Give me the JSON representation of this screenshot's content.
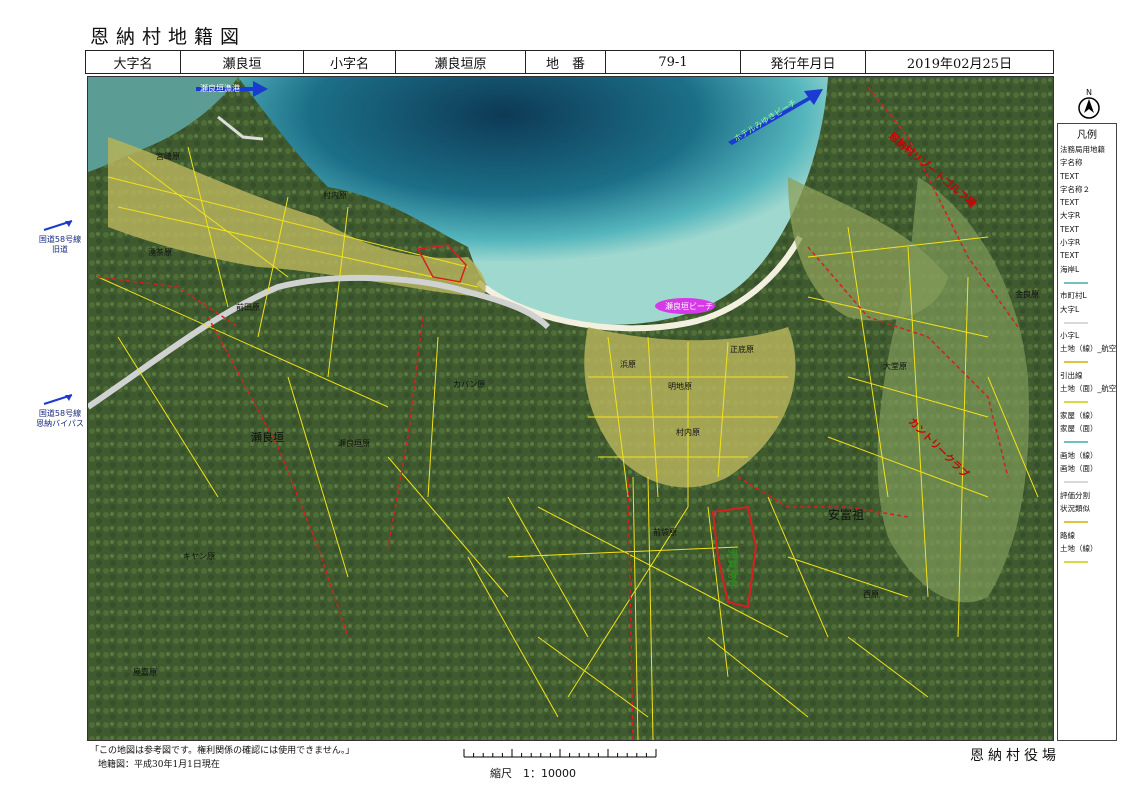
{
  "title": "恩納村地籍図",
  "header": {
    "oaza_label": "大字名",
    "oaza_value": "瀬良垣",
    "koaza_label": "小字名",
    "koaza_value": "瀬良垣原",
    "chiban_label": "地　番",
    "chiban_value": "79-1",
    "date_label": "発行年月日",
    "date_value": "2019年02月25日"
  },
  "map": {
    "labels": {
      "port": "瀬良垣漁港",
      "hotel": "ホテルみゆきビーチ",
      "beach": "瀬良垣ビーチ",
      "p1": "宮崎原",
      "p2": "村内原",
      "p3": "湧茶原",
      "p4": "前田原",
      "p5": "浜原",
      "p6": "正底原",
      "p7": "明地原",
      "p8": "村内原",
      "p9": "大堂原",
      "p10": "金良原",
      "p11": "カバン原",
      "p12": "瀬良垣",
      "p13": "瀬良垣原",
      "p14": "キヤン原",
      "p15": "前袋原",
      "p16": "安富祖",
      "p17": "西原",
      "p18": "屋嘉原",
      "property": "売買物件",
      "resort1": "恩納村リゾートゴルフ場",
      "resort2": "カントリークラブ"
    },
    "left_notes": {
      "note1_line1": "国道58号線",
      "note1_line2": "旧道",
      "note2_line1": "国道58号線",
      "note2_line2": "恩納バイパス"
    }
  },
  "legend": {
    "title": "凡例",
    "items": [
      "法務局用地籍",
      "字名称",
      "TEXT",
      "字名称２",
      "TEXT",
      "大字R",
      "TEXT",
      "小字R",
      "TEXT",
      "海岸L",
      "市町村L",
      "大字L",
      "小字L",
      "土地（線）_航空",
      "引出線",
      "土地（面）_航空",
      "家屋（線）",
      "家屋（面）",
      "画地（線）",
      "画地（面）",
      "評価分割",
      "状況類似",
      "路線",
      "土地（線）"
    ],
    "sample_colors": [
      "#4aa",
      "#ccc",
      "#ccc",
      "#ccc",
      "#d4b200",
      "#aaa",
      "#cc0",
      "#333"
    ]
  },
  "footer": {
    "note1": "「この地図は参考図です。権利関係の確認には使用できません。」",
    "note2": "地籍図：平成30年1月1日現在",
    "scale": "縮尺　1：10000",
    "office": "恩納村役場"
  },
  "north_label": "N"
}
